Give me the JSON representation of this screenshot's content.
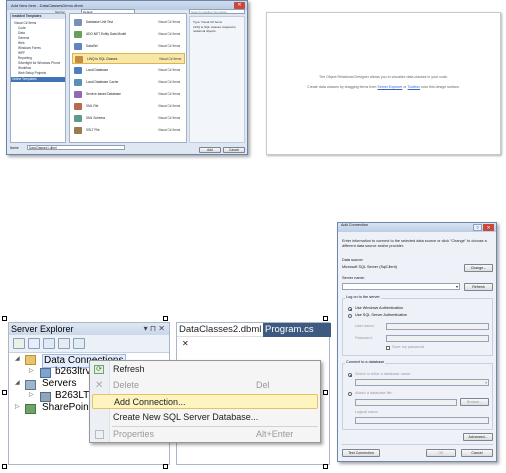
{
  "add_new_item": {
    "title": "Add New Item - DataClassesDemo.dbml",
    "installed_templates_header": "Installed Templates",
    "tree": [
      "Visual C# Items",
      "Code",
      "Data",
      "General",
      "Web",
      "Windows Forms",
      "WPF",
      "Reporting",
      "Silverlight for Windows Phone",
      "Workflow",
      "Web Setup Projects"
    ],
    "selected_category": "Online Templates",
    "sort_label": "Sort by:",
    "sort_value": "Default",
    "search_placeholder": "Search Installed Templates",
    "templates": [
      {
        "name": "Database Unit Test",
        "type": "Visual C# Items",
        "color": "#7a8fb8"
      },
      {
        "name": "ADO.NET Entity Data Model",
        "type": "Visual C# Items",
        "color": "#6a9e5b"
      },
      {
        "name": "DataSet",
        "type": "Visual C# Items",
        "color": "#5e84c4"
      },
      {
        "name": "LINQ to SQL Classes",
        "type": "Visual C# Items",
        "color": "#c98a3c"
      },
      {
        "name": "Local Database",
        "type": "Visual C# Items",
        "color": "#4f7fc1"
      },
      {
        "name": "Local Database Cache",
        "type": "Visual C# Items",
        "color": "#5a8fb7"
      },
      {
        "name": "Service-based Database",
        "type": "Visual C# Items",
        "color": "#8e6bb5"
      },
      {
        "name": "XML File",
        "type": "Visual C# Items",
        "color": "#b86a4c"
      },
      {
        "name": "XML Schema",
        "type": "Visual C# Items",
        "color": "#5f9a8a"
      },
      {
        "name": "XSLT File",
        "type": "Visual C# Items",
        "color": "#9a7c4f"
      }
    ],
    "details_type": "Type: Visual C# Items",
    "details_desc": "LINQ to SQL classes mapped to relational objects.",
    "name_label": "Name:",
    "name_value": "DataClasses1.dbml",
    "add_label": "Add",
    "cancel_label": "Cancel"
  },
  "designer": {
    "line1": "The Object Relational Designer allows you to visualize data classes in your code.",
    "line2_pre": "Create data classes by dragging items from ",
    "line2_link1": "Server Explorer",
    "line2_mid": " or ",
    "line2_link2": "Toolbox",
    "line2_post": " onto this design surface."
  },
  "server_explorer": {
    "title": "Server Explorer",
    "title_icons": "▾ ⊓ ✕",
    "nodes": [
      "Data Connections",
      "b263ltrv\\s",
      "Servers",
      "B263LTRV",
      "SharePoint C"
    ]
  },
  "tabs": [
    {
      "label": "DataClasses2.dbml",
      "close": "✕"
    },
    {
      "label": "Program.cs"
    }
  ],
  "context_menu": {
    "items": [
      {
        "label": "Refresh",
        "shortcut": ""
      },
      {
        "label": "Delete",
        "shortcut": "Del"
      },
      {
        "label": "Add Connection...",
        "shortcut": ""
      },
      {
        "label": "Create New SQL Server Database...",
        "shortcut": ""
      },
      {
        "label": "Properties",
        "shortcut": "Alt+Enter"
      }
    ],
    "colors": {
      "highlight": "#fdf4bf",
      "highlight_border": "#e5c365"
    }
  },
  "add_connection": {
    "title": "Add Connection",
    "help": "?",
    "close": "✕",
    "intro": "Enter information to connect to the selected data source or click \"Change\" to choose a different data source and/or provider.",
    "data_source_label": "Data source:",
    "data_source_value": "Microsoft SQL Server (SqlClient)",
    "change_label": "Change...",
    "server_name_label": "Server name:",
    "refresh_label": "Refresh",
    "logon_label": "Log on to the server",
    "win_auth": "Use Windows Authentication",
    "sql_auth": "Use SQL Server Authentication",
    "user_name_label": "User name:",
    "password_label": "Password:",
    "save_password": "Save my password",
    "connect_db_label": "Connect to a database",
    "select_db": "Select or enter a database name:",
    "attach_db": "Attach a database file:",
    "browse_label": "Browse...",
    "logical_name_label": "Logical name:",
    "advanced_label": "Advanced...",
    "test_label": "Test Connection",
    "ok_label": "OK",
    "cancel_label": "Cancel"
  }
}
